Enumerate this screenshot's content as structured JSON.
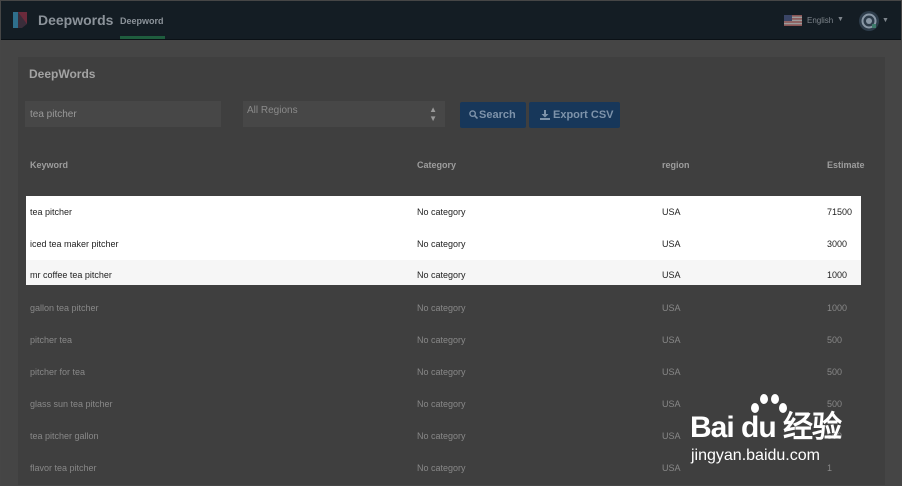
{
  "navbar": {
    "brand": "Deepwords",
    "tab": "Deepword",
    "language": "English"
  },
  "panel": {
    "title": "DeepWords",
    "search": {
      "value": "tea pitcher",
      "placeholder": ""
    },
    "region_select": {
      "selected": "All Regions"
    },
    "search_button": "Search",
    "export_button": "Export CSV"
  },
  "table": {
    "headers": [
      "Keyword",
      "Category",
      "region",
      "Estimate"
    ],
    "rows": [
      {
        "keyword": "tea pitcher",
        "category": "No category",
        "region": "USA",
        "estimate": "71500"
      },
      {
        "keyword": "iced tea maker pitcher",
        "category": "No category",
        "region": "USA",
        "estimate": "3000"
      },
      {
        "keyword": "mr coffee tea pitcher",
        "category": "No category",
        "region": "USA",
        "estimate": "1000"
      },
      {
        "keyword": "gallon tea pitcher",
        "category": "No category",
        "region": "USA",
        "estimate": "1000"
      },
      {
        "keyword": "pitcher tea",
        "category": "No category",
        "region": "USA",
        "estimate": "500"
      },
      {
        "keyword": "pitcher for tea",
        "category": "No category",
        "region": "USA",
        "estimate": "500"
      },
      {
        "keyword": "glass sun tea pitcher",
        "category": "No category",
        "region": "USA",
        "estimate": "500"
      },
      {
        "keyword": "tea pitcher gallon",
        "category": "No category",
        "region": "USA",
        "estimate": "500"
      },
      {
        "keyword": "flavor tea pitcher",
        "category": "No category",
        "region": "USA",
        "estimate": "1"
      }
    ]
  },
  "watermark": {
    "main": "Bai du 经验",
    "url": "jingyan.baidu.com"
  },
  "colors": {
    "navbar": "#141d24",
    "button": "#17375a",
    "nav_underline": "#1f5d3e"
  }
}
